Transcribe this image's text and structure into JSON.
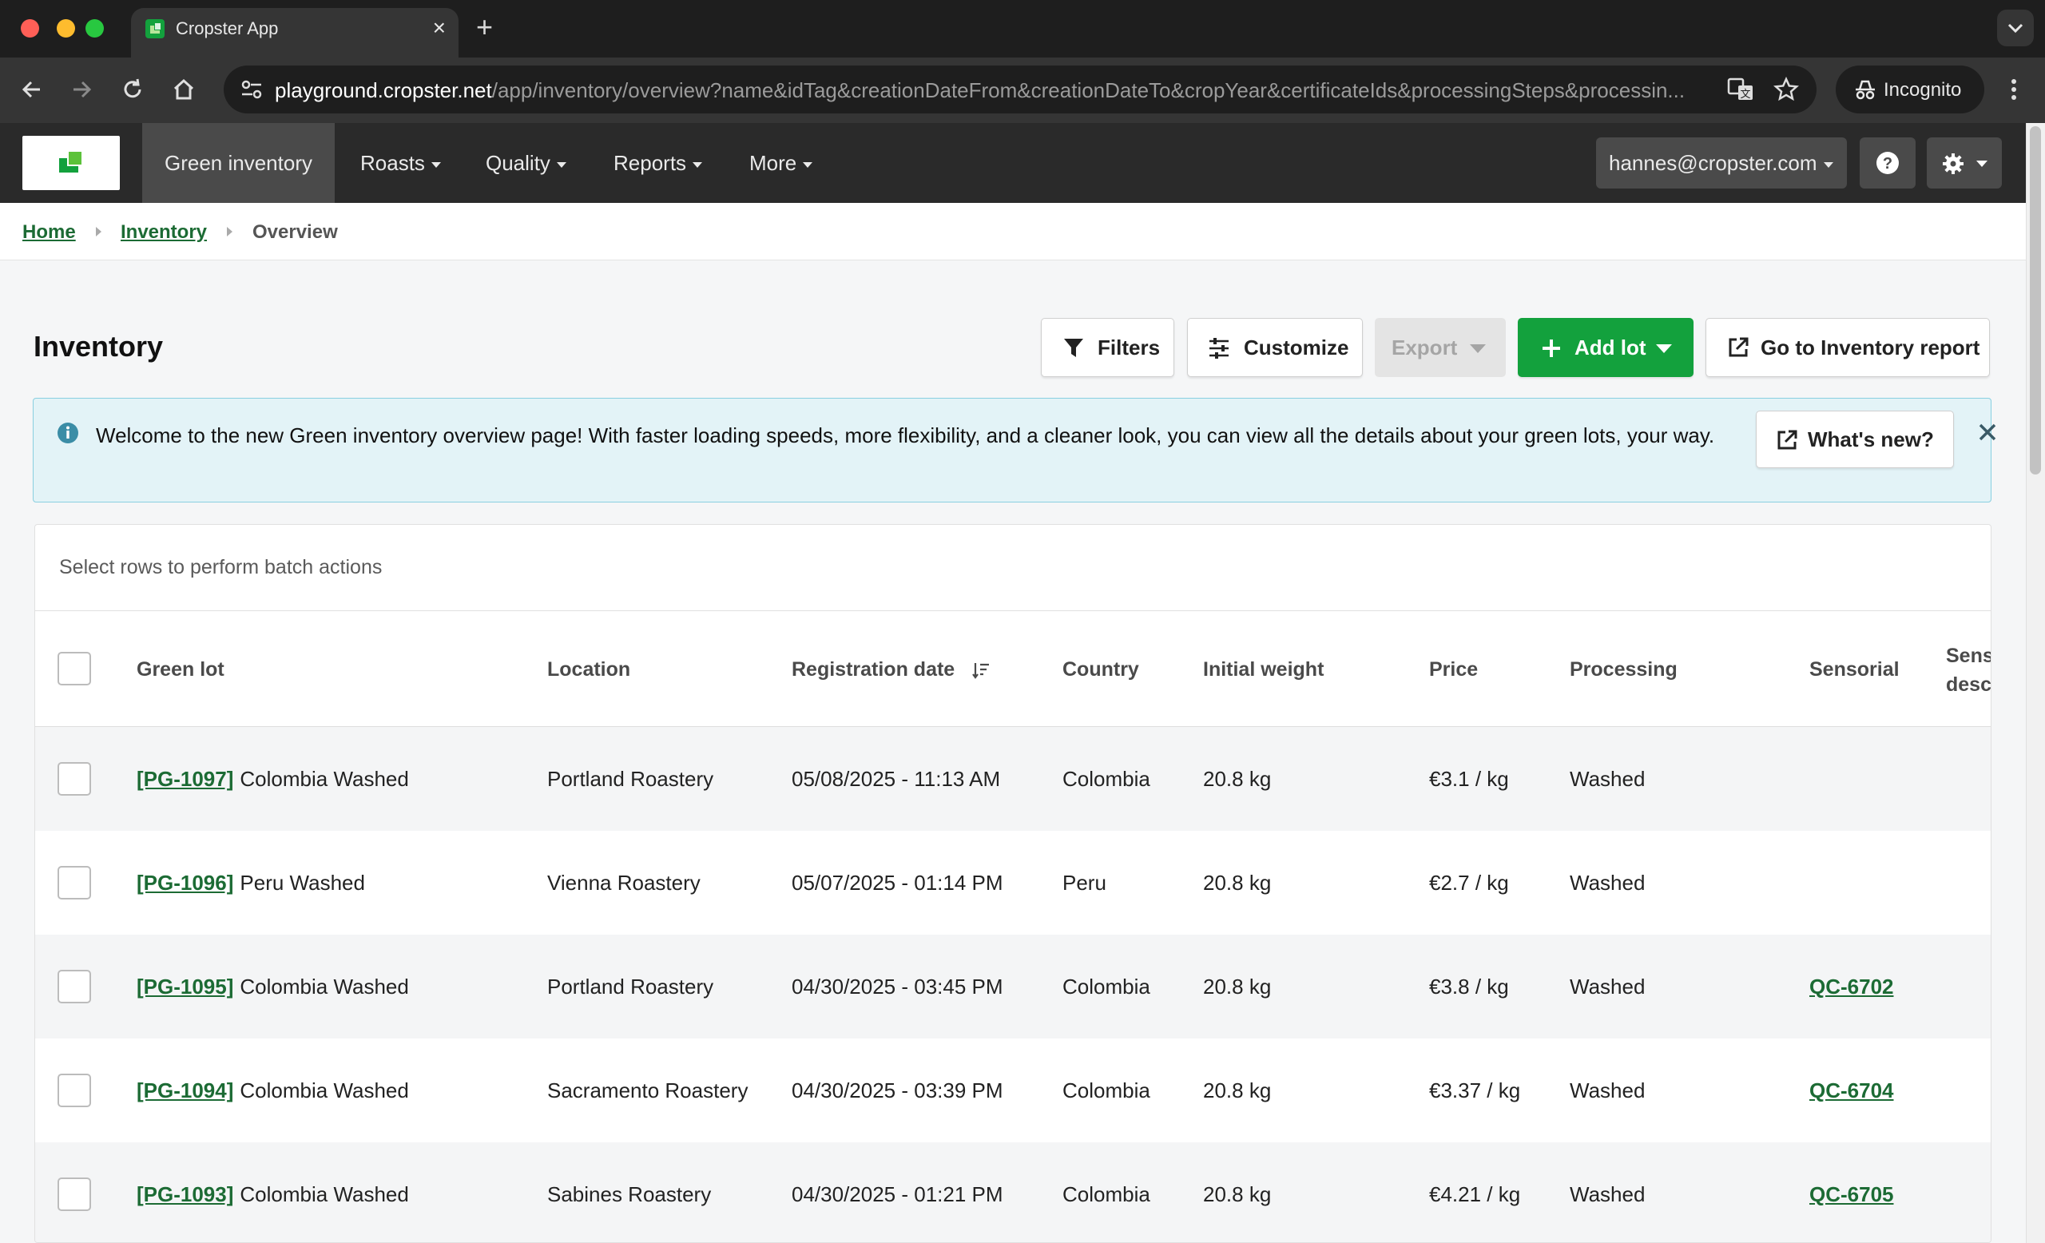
{
  "browser": {
    "tab_title": "Cropster App",
    "url_host": "playground.cropster.net",
    "url_path": "/app/inventory/overview?name&idTag&creationDateFrom&creationDateTo&cropYear&certificateIds&processingSteps&processin...",
    "incognito_label": "Incognito"
  },
  "nav": {
    "items": [
      "Green inventory",
      "Roasts",
      "Quality",
      "Reports",
      "More"
    ],
    "user_email": "hannes@cropster.com"
  },
  "breadcrumb": {
    "home": "Home",
    "inventory": "Inventory",
    "current": "Overview"
  },
  "page": {
    "title": "Inventory"
  },
  "toolbar": {
    "filters": "Filters",
    "customize": "Customize",
    "export": "Export",
    "add_lot": "Add lot",
    "go_report": "Go to Inventory report"
  },
  "alert": {
    "text": "Welcome to the new Green inventory overview page! With faster loading speeds, more flexibility, and a cleaner look, you can view all the details about your green lots, your way.",
    "button": "What's new?"
  },
  "table": {
    "batch_hint": "Select rows to perform batch actions",
    "columns": {
      "green_lot": "Green lot",
      "location": "Location",
      "registration_date": "Registration date",
      "country": "Country",
      "initial_weight": "Initial weight",
      "price": "Price",
      "processing": "Processing",
      "sensorial": "Sensorial",
      "sensorial_desc": "Sensorial descriptors"
    },
    "rows": [
      {
        "id": "[PG-1097]",
        "name": "Colombia Washed",
        "location": "Portland Roastery",
        "date": "05/08/2025 - 11:13 AM",
        "country": "Colombia",
        "weight": "20.8 kg",
        "price": "€3.1 / kg",
        "processing": "Washed",
        "sensorial": ""
      },
      {
        "id": "[PG-1096]",
        "name": "Peru Washed",
        "location": "Vienna Roastery",
        "date": "05/07/2025 - 01:14 PM",
        "country": "Peru",
        "weight": "20.8 kg",
        "price": "€2.7 / kg",
        "processing": "Washed",
        "sensorial": ""
      },
      {
        "id": "[PG-1095]",
        "name": "Colombia Washed",
        "location": "Portland Roastery",
        "date": "04/30/2025 - 03:45 PM",
        "country": "Colombia",
        "weight": "20.8 kg",
        "price": "€3.8 / kg",
        "processing": "Washed",
        "sensorial": "QC-6702"
      },
      {
        "id": "[PG-1094]",
        "name": "Colombia Washed",
        "location": "Sacramento Roastery",
        "date": "04/30/2025 - 03:39 PM",
        "country": "Colombia",
        "weight": "20.8 kg",
        "price": "€3.37 / kg",
        "processing": "Washed",
        "sensorial": "QC-6704"
      },
      {
        "id": "[PG-1093]",
        "name": "Colombia Washed",
        "location": "Sabines Roastery",
        "date": "04/30/2025 - 01:21 PM",
        "country": "Colombia",
        "weight": "20.8 kg",
        "price": "€4.21 / kg",
        "processing": "Washed",
        "sensorial": "QC-6705"
      }
    ]
  },
  "colors": {
    "brand_green": "#13a13d",
    "link_green": "#1c6b34",
    "alert_bg": "#e3f3f7"
  },
  "icons": [
    "translate-icon",
    "star-icon",
    "incognito-icon",
    "filter-icon",
    "sliders-icon",
    "plus-icon",
    "external-link-icon",
    "info-icon",
    "close-icon",
    "sort-icon",
    "help-icon",
    "gear-icon"
  ]
}
